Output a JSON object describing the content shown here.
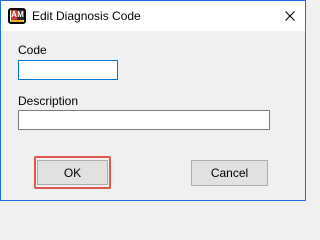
{
  "window": {
    "title": "Edit Diagnosis Code",
    "icon": "am-app-icon",
    "icon_letters": {
      "left": "A",
      "right": "M"
    }
  },
  "controls": {
    "close_icon": "close-icon"
  },
  "form": {
    "code_label": "Code",
    "code_value": "",
    "description_label": "Description",
    "description_value": ""
  },
  "buttons": {
    "ok_label": "OK",
    "cancel_label": "Cancel"
  },
  "colors": {
    "window_border": "#1f6fd6",
    "focus_border": "#0078d7",
    "highlight": "#e2574c"
  }
}
